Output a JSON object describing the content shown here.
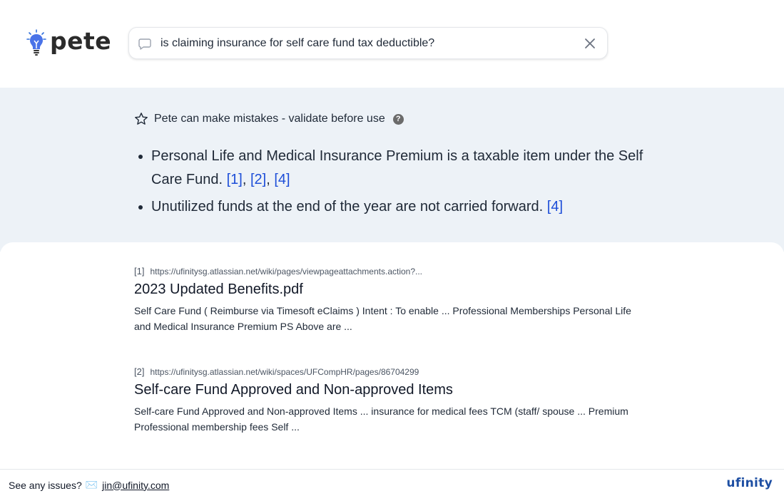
{
  "app": {
    "name": "pete"
  },
  "search": {
    "query": "is claiming insurance for self care fund tax deductible?",
    "placeholder": ""
  },
  "answer": {
    "warning": "Pete can make mistakes - validate before use",
    "help_label": "?",
    "bullets": [
      {
        "text": "Personal Life and Medical Insurance Premium is a taxable item under the Self Care Fund.",
        "citations": [
          "[1]",
          "[2]",
          "[4]"
        ]
      },
      {
        "text": "Unutilized funds at the end of the year are not carried forward.",
        "citations": [
          "[4]"
        ]
      }
    ]
  },
  "results": [
    {
      "num": "[1]",
      "url": "https://ufinitysg.atlassian.net/wiki/pages/viewpageattachments.action?...",
      "title": "2023 Updated Benefits.pdf",
      "snippet": "Self Care Fund ( Reimburse via Timesoft eClaims ) Intent : To enable ... Professional Memberships Personal Life and Medical Insurance Premium PS Above are ..."
    },
    {
      "num": "[2]",
      "url": "https://ufinitysg.atlassian.net/wiki/spaces/UFCompHR/pages/86704299",
      "title": "Self-care Fund Approved and Non-approved Items",
      "snippet": "Self-care Fund Approved and Non-approved Items ... insurance for medical fees TCM (staff/ spouse ... Premium Professional membership fees Self ..."
    }
  ],
  "footer": {
    "text": "See any issues?",
    "mail_icon": "✉️",
    "email": "jin@ufinity.com",
    "brand": "ufinity"
  },
  "colors": {
    "answer_bg": "#edf2f7",
    "citation": "#1d4ed8",
    "brand": "#1e4fa3",
    "logo_bulb": "#3b5bdb"
  }
}
